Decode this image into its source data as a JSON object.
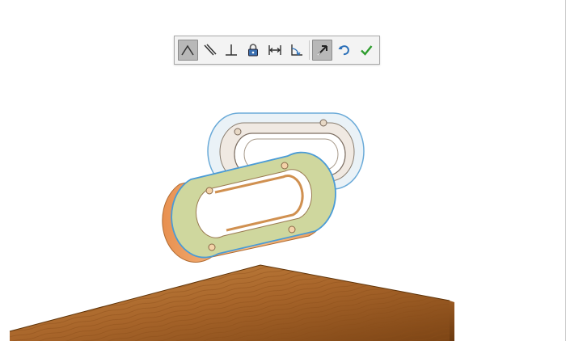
{
  "window": {
    "title": ""
  },
  "toolbar": {
    "buttons": [
      {
        "name": "coincident-mate-button",
        "icon": "angle-icon",
        "active": true
      },
      {
        "name": "parallel-mate-button",
        "icon": "parallel-icon",
        "active": false
      },
      {
        "name": "perpendicular-mate-button",
        "icon": "perpendicular-icon",
        "active": false
      },
      {
        "name": "lock-mate-button",
        "icon": "lock-icon",
        "active": false
      },
      {
        "name": "distance-mate-button",
        "icon": "distance-icon",
        "active": false
      },
      {
        "name": "angle-mate-button",
        "icon": "angle-arc-icon",
        "active": false
      },
      {
        "name": "flip-alignment-button",
        "icon": "flip-arrow-icon",
        "active": true
      },
      {
        "name": "undo-button",
        "icon": "undo-icon",
        "active": false
      },
      {
        "name": "ok-button",
        "icon": "checkmark-icon",
        "active": false
      }
    ]
  },
  "colors": {
    "toolbar_bg": "#f3f3f3",
    "wood": "#b8742f",
    "part_orange": "#f0a86a",
    "part_face_green": "#c8d49a",
    "transparent_part": "#cfe0ea",
    "selection_edge": "#4a9bd6",
    "check_green": "#2e9d2e",
    "undo_blue": "#2a6fb8"
  }
}
